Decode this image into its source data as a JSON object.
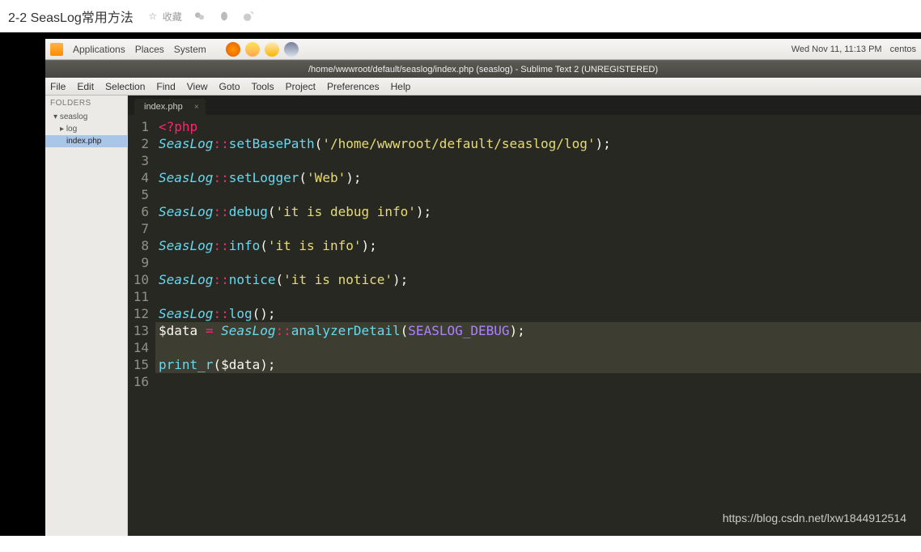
{
  "header": {
    "title": "2-2 SeasLog常用方法",
    "favorite": "收藏"
  },
  "gnome": {
    "applications": "Applications",
    "places": "Places",
    "system": "System",
    "datetime": "Wed Nov 11, 11:13 PM",
    "user": "centos"
  },
  "sublime": {
    "title": "/home/wwwroot/default/seaslog/index.php (seaslog) - Sublime Text 2 (UNREGISTERED)",
    "menus": [
      "File",
      "Edit",
      "Selection",
      "Find",
      "View",
      "Goto",
      "Tools",
      "Project",
      "Preferences",
      "Help"
    ]
  },
  "sidebar": {
    "header": "FOLDERS",
    "root": "seaslog",
    "folder": "log",
    "file": "index.php"
  },
  "tab": {
    "name": "index.php"
  },
  "code": {
    "lines": [
      {
        "type": "php-open"
      },
      {
        "type": "call",
        "class": "SeasLog",
        "method": "setBasePath",
        "arg_str": "'/home/wwwroot/default/seaslog/log'"
      },
      {
        "type": "empty"
      },
      {
        "type": "call",
        "class": "SeasLog",
        "method": "setLogger",
        "arg_str": "'Web'"
      },
      {
        "type": "empty"
      },
      {
        "type": "call",
        "class": "SeasLog",
        "method": "debug",
        "arg_str": "'it is debug info'"
      },
      {
        "type": "empty"
      },
      {
        "type": "call",
        "class": "SeasLog",
        "method": "info",
        "arg_str": "'it is info'"
      },
      {
        "type": "empty"
      },
      {
        "type": "call",
        "class": "SeasLog",
        "method": "notice",
        "arg_str": "'it is notice'"
      },
      {
        "type": "empty"
      },
      {
        "type": "call",
        "class": "SeasLog",
        "method": "log",
        "arg_str": ""
      },
      {
        "type": "assign",
        "var": "$data",
        "class": "SeasLog",
        "method": "analyzerDetail",
        "const": "SEASLOG_DEBUG"
      },
      {
        "type": "empty"
      },
      {
        "type": "print",
        "func": "print_r",
        "var": "$data"
      },
      {
        "type": "empty"
      }
    ],
    "highlight_lines": [
      13,
      14,
      15
    ]
  },
  "watermark": "https://blog.csdn.net/lxw1844912514"
}
